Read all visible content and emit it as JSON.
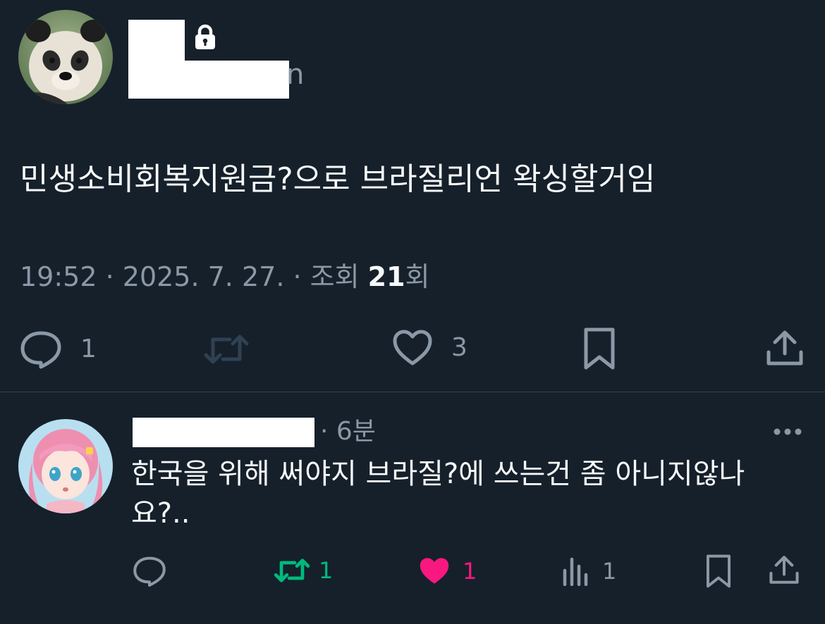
{
  "tweet": {
    "handle_tail": "n",
    "text": "민생소비회복지원금?으로 브라질리언 왁싱할거임",
    "meta": {
      "time": "19:52",
      "sep1": " · ",
      "date": "2025. 7. 27.",
      "sep2": " · ",
      "views_label": "조회 ",
      "views_count": "21",
      "views_suffix": "회"
    },
    "actions": {
      "reply_icon": "reply-bubble-icon",
      "reply_count": "1",
      "retweet_icon": "retweet-icon",
      "like_icon": "heart-icon",
      "like_count": "3",
      "bookmark_icon": "bookmark-icon",
      "share_icon": "share-icon"
    }
  },
  "reply": {
    "time": "· 6분",
    "text": "한국을 위해 써야지 브라질?에 쓰는건 좀 아니지않나요?..",
    "more_icon": "more-dots-icon",
    "actions": {
      "retweet_count": "1",
      "like_count": "1",
      "views_count": "1"
    }
  },
  "colors": {
    "background": "#15202b",
    "text_primary": "#f7f9f9",
    "text_secondary": "#8b98a5",
    "retweet_active": "#00ba7c",
    "like_active": "#f91880",
    "divider": "#38444d"
  }
}
